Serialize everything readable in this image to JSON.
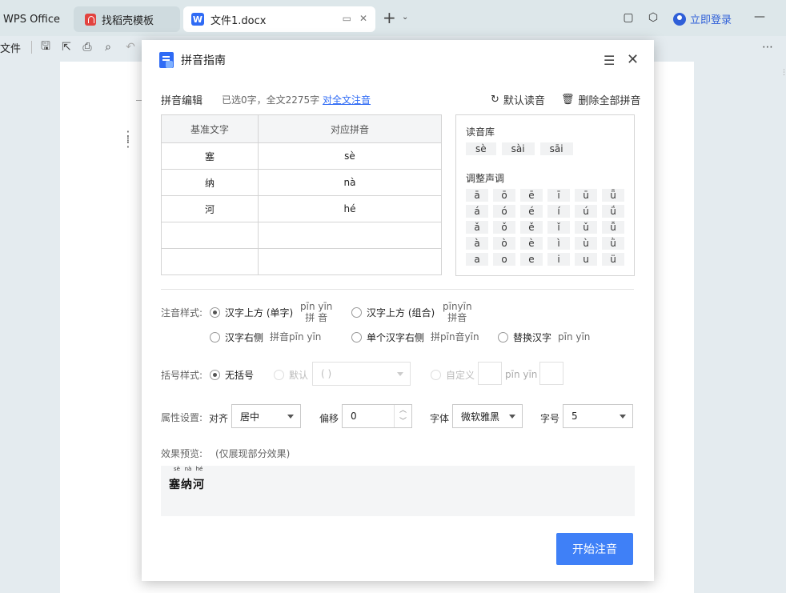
{
  "tabs": {
    "app": "WPS Office",
    "template": "找稻壳模板",
    "document": "文件1.docx",
    "doc_icon_letter": "W",
    "login": "立即登录"
  },
  "toolbar": {
    "file": "文件"
  },
  "dialog": {
    "title": "拼音指南",
    "edit_label": "拼音编辑",
    "info": "已选0字，全文2275字",
    "full_text_link": "对全文注音",
    "default_reading": "默认读音",
    "delete_all": "删除全部拼音",
    "table": {
      "headers": [
        "基准文字",
        "对应拼音"
      ],
      "rows": [
        [
          "塞",
          "sè"
        ],
        [
          "纳",
          "nà"
        ],
        [
          "河",
          "hé"
        ],
        [
          "",
          ""
        ],
        [
          "",
          ""
        ]
      ]
    },
    "readings": {
      "title": "读音库",
      "chips": [
        "sè",
        "sài",
        "sāi"
      ],
      "tone_title": "调整声调",
      "tones": [
        "ā",
        "ō",
        "ē",
        "ī",
        "ū",
        "ǖ",
        "á",
        "ó",
        "é",
        "í",
        "ú",
        "ǘ",
        "ǎ",
        "ǒ",
        "ě",
        "ǐ",
        "ǔ",
        "ǚ",
        "à",
        "ò",
        "è",
        "ì",
        "ù",
        "ǜ",
        "a",
        "o",
        "e",
        "i",
        "u",
        "ü"
      ]
    },
    "style": {
      "label": "注音样式:",
      "opt1": "汉字上方 (单字)",
      "opt1_ex_top": "pīn yīn",
      "opt1_ex_bottom": "拼  音",
      "opt2": "汉字上方 (组合)",
      "opt2_ex_top": "pīnyīn",
      "opt2_ex_bottom": "拼音",
      "opt3": "汉字右侧",
      "opt3_ex": "拼音pīn yīn",
      "opt4": "单个汉字右侧",
      "opt4_ex": "拼pīn音yīn",
      "opt5": "替换汉字",
      "opt5_ex": "pīn yīn"
    },
    "bracket": {
      "label": "括号样式:",
      "opt1": "无括号",
      "opt2": "默认",
      "opt2_value": "( )",
      "opt3": "自定义",
      "sample": "pīn yīn"
    },
    "attrs": {
      "label": "属性设置:",
      "align_label": "对齐",
      "align_value": "居中",
      "offset_label": "偏移",
      "offset_value": "0",
      "font_label": "字体",
      "font_value": "微软雅黑",
      "size_label": "字号",
      "size_value": "5"
    },
    "preview": {
      "label": "效果预览:",
      "note": "(仅展现部分效果)",
      "pinyin": [
        "sè",
        "nà",
        "hé"
      ],
      "text": "塞纳河"
    },
    "start_button": "开始注音"
  }
}
